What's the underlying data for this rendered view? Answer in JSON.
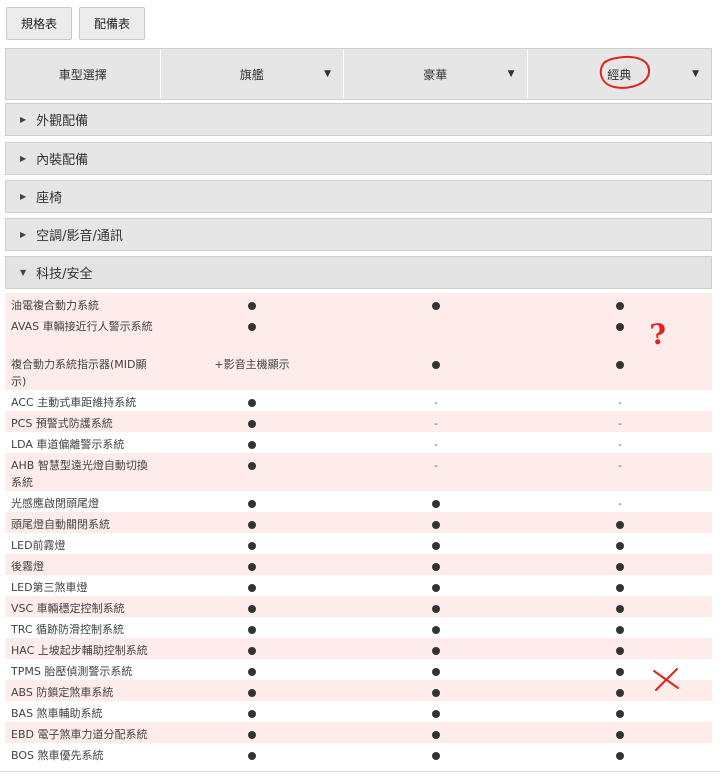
{
  "tabs": [
    "規格表",
    "配備表"
  ],
  "selector": {
    "label": "車型選擇",
    "models": [
      "旗艦",
      "豪華",
      "經典"
    ]
  },
  "sections": [
    "外觀配備",
    "內裝配備",
    "座椅",
    "空調/影音/通訊",
    "科技/安全"
  ],
  "rows": [
    {
      "name": "油電複合動力系統",
      "values": [
        "dot",
        "dot",
        "dot"
      ]
    },
    {
      "name": "AVAS 車輛接近行人警示系統",
      "values": [
        "dot",
        "",
        "dot"
      ]
    },
    {
      "name": "複合動力系統指示器(MID顯示)",
      "values": [
        "+影音主機顯示",
        "dot",
        "dot"
      ]
    },
    {
      "name": "ACC 主動式車距維持系統",
      "values": [
        "dot",
        "-",
        "-"
      ]
    },
    {
      "name": "PCS 預警式防護系統",
      "values": [
        "dot",
        "-",
        "-"
      ]
    },
    {
      "name": "LDA 車道偏離警示系統",
      "values": [
        "dot",
        "-",
        "-"
      ]
    },
    {
      "name": "AHB 智慧型遠光燈自動切換系統",
      "values": [
        "dot",
        "-",
        "-"
      ]
    },
    {
      "name": "光感應啟閉頭尾燈",
      "values": [
        "dot",
        "dot",
        "-"
      ]
    },
    {
      "name": "頭尾燈自動關閉系統",
      "values": [
        "dot",
        "dot",
        "dot"
      ]
    },
    {
      "name": "LED前霧燈",
      "values": [
        "dot",
        "dot",
        "dot"
      ]
    },
    {
      "name": "後霧燈",
      "values": [
        "dot",
        "dot",
        "dot"
      ]
    },
    {
      "name": "LED第三煞車燈",
      "values": [
        "dot",
        "dot",
        "dot"
      ]
    },
    {
      "name": "VSC 車輛穩定控制系統",
      "values": [
        "dot",
        "dot",
        "dot"
      ]
    },
    {
      "name": "TRC 循跡防滑控制系統",
      "values": [
        "dot",
        "dot",
        "dot"
      ]
    },
    {
      "name": "HAC 上坡起步輔助控制系統",
      "values": [
        "dot",
        "dot",
        "dot"
      ]
    },
    {
      "name": "TPMS 胎壓偵測警示系統",
      "values": [
        "dot",
        "dot",
        "dot"
      ]
    },
    {
      "name": "ABS 防鎖定煞車系統",
      "values": [
        "dot",
        "dot",
        "dot"
      ]
    },
    {
      "name": "BAS 煞車輔助系統",
      "values": [
        "dot",
        "dot",
        "dot"
      ]
    },
    {
      "name": "EBD 電子煞車力道分配系統",
      "values": [
        "dot",
        "dot",
        "dot"
      ]
    },
    {
      "name": "BOS 煞車優先系統",
      "values": [
        "dot",
        "dot",
        "dot"
      ]
    }
  ],
  "annotations": {
    "question": "?"
  },
  "colors": {
    "alt_row": "#fdecea",
    "annotation": "#e0241b",
    "panel": "#e6e6e6"
  }
}
